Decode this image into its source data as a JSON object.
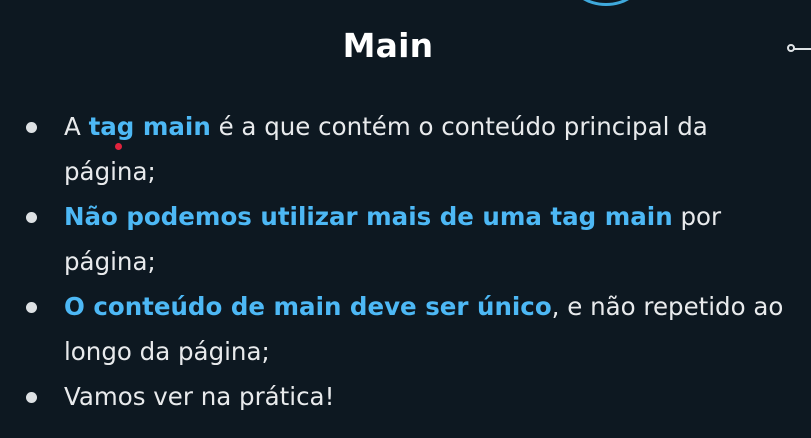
{
  "slide": {
    "title": "Main",
    "bullets": [
      {
        "parts": [
          {
            "text": "A ",
            "highlight": false
          },
          {
            "text": "tag main",
            "highlight": true
          },
          {
            "text": " é a que contém o conteúdo principal da página;",
            "highlight": false
          }
        ]
      },
      {
        "parts": [
          {
            "text": "Não podemos utilizar mais de uma tag main",
            "highlight": true
          },
          {
            "text": " por página;",
            "highlight": false
          }
        ]
      },
      {
        "parts": [
          {
            "text": "O conteúdo de main deve ser único",
            "highlight": true
          },
          {
            "text": ", e não repetido ao longo da página;",
            "highlight": false
          }
        ]
      },
      {
        "parts": [
          {
            "text": "Vamos ver na prática!",
            "highlight": false
          }
        ]
      }
    ]
  },
  "colors": {
    "background": "#0d1821",
    "text": "#e8eaec",
    "highlight": "#4db8f5",
    "accent_circle": "#3fa9dc",
    "annotation_dot": "#e0233d"
  }
}
